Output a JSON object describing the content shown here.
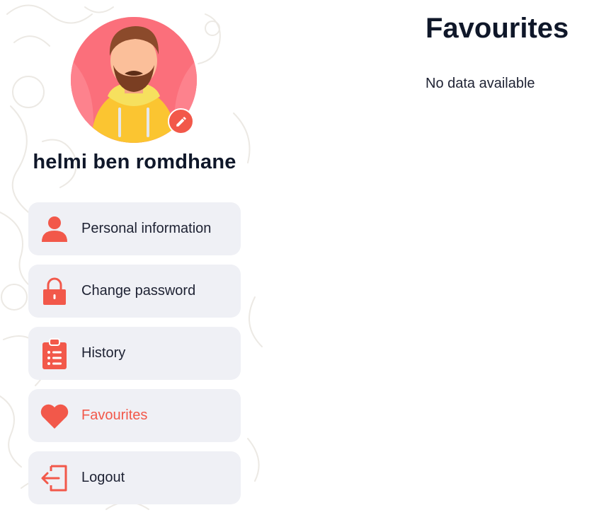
{
  "profile": {
    "name": "helmi ben romdhane"
  },
  "menu": {
    "items": [
      {
        "label": "Personal information",
        "icon": "user-icon"
      },
      {
        "label": "Change password",
        "icon": "lock-icon"
      },
      {
        "label": "History",
        "icon": "clipboard-list-icon"
      },
      {
        "label": "Favourites",
        "icon": "heart-icon",
        "active": true
      },
      {
        "label": "Logout",
        "icon": "logout-icon"
      }
    ]
  },
  "main": {
    "title": "Favourites",
    "empty_text": "No data available"
  },
  "colors": {
    "accent": "#f2584a",
    "menu_bg": "#eff0f5",
    "heading": "#0f1729",
    "text": "#1e2233"
  }
}
